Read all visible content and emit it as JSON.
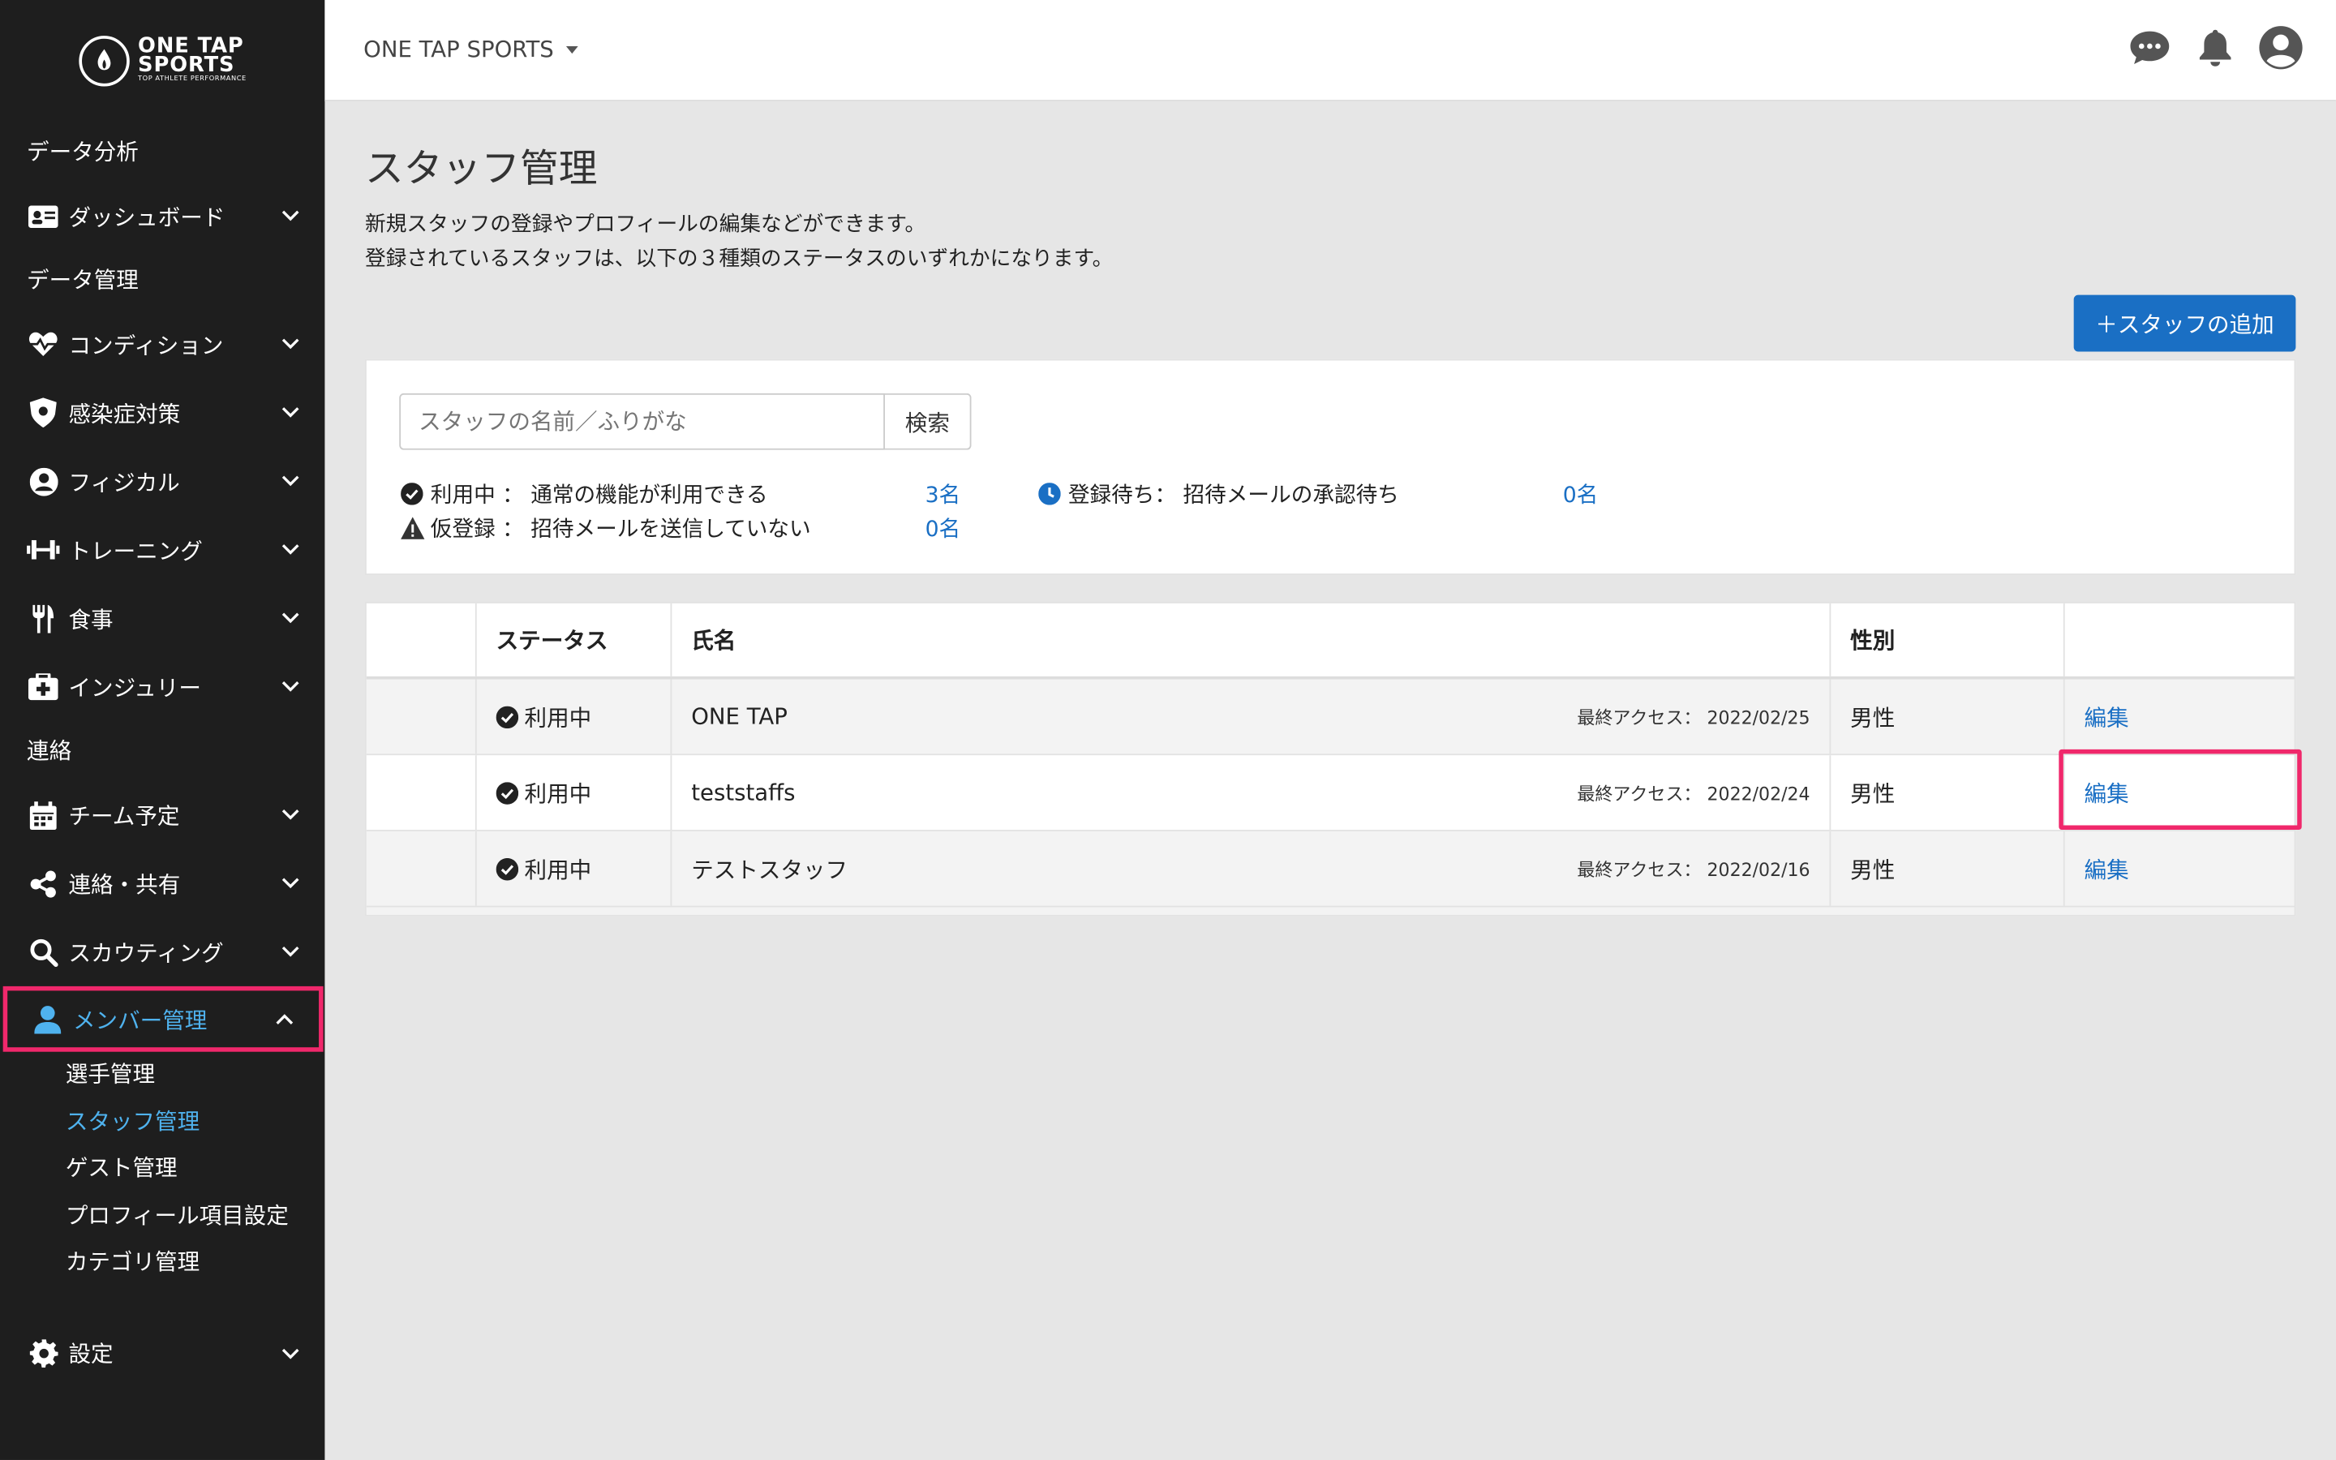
{
  "brand": {
    "line1": "ONE TAP",
    "line2": "SPORTS",
    "tagline": "TOP ATHLETE PERFORMANCE"
  },
  "header": {
    "team_name": "ONE TAP SPORTS"
  },
  "sidebar": {
    "sections": {
      "analysis": "データ分析",
      "data_mgmt": "データ管理",
      "contact": "連絡"
    },
    "items": {
      "dashboard": "ダッシュボード",
      "condition": "コンディション",
      "infection": "感染症対策",
      "physical": "フィジカル",
      "training": "トレーニング",
      "meal": "食事",
      "injury": "インジュリー",
      "schedule": "チーム予定",
      "share": "連絡・共有",
      "scouting": "スカウティング",
      "member": "メンバー管理",
      "settings": "設定"
    },
    "member_sub": {
      "players": "選手管理",
      "staff": "スタッフ管理",
      "guests": "ゲスト管理",
      "profile_items": "プロフィール項目設定",
      "categories": "カテゴリ管理"
    }
  },
  "page": {
    "title": "スタッフ管理",
    "desc1": "新規スタッフの登録やプロフィールの編集などができます。",
    "desc2": "登録されているスタッフは、以下の３種類のステータスのいずれかになります。",
    "add_button": "＋スタッフの追加"
  },
  "search": {
    "placeholder": "スタッフの名前／ふりがな",
    "button": "検索"
  },
  "stats": {
    "active_label": "利用中 ： 通常の機能が利用できる",
    "active_count": "3名",
    "provisional_label": "仮登録 ： 招待メールを送信していない",
    "provisional_count": "0名",
    "pending_label": "登録待ち： 招待メールの承認待ち",
    "pending_count": "0名"
  },
  "table": {
    "headers": {
      "status": "ステータス",
      "name": "氏名",
      "gender": "性別"
    },
    "rows": [
      {
        "status": "利用中",
        "name": "ONE TAP",
        "access": "最終アクセス： 2022/02/25",
        "gender": "男性",
        "edit": "編集"
      },
      {
        "status": "利用中",
        "name": "teststaffs",
        "access": "最終アクセス： 2022/02/24",
        "gender": "男性",
        "edit": "編集"
      },
      {
        "status": "利用中",
        "name": "テストスタッフ",
        "access": "最終アクセス： 2022/02/16",
        "gender": "男性",
        "edit": "編集"
      }
    ]
  },
  "colors": {
    "sidebar_bg": "#1e1e1e",
    "accent": "#1a6fc4",
    "active_nav": "#4fb2ee",
    "highlight": "#f0286b"
  }
}
